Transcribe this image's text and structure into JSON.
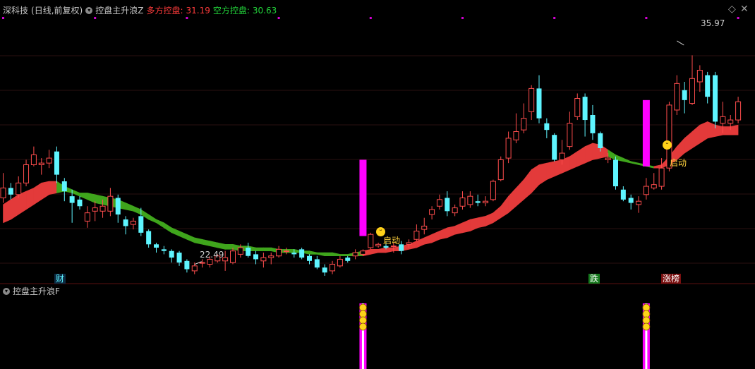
{
  "header": {
    "stock": "深科技",
    "period": "(日线,前复权)",
    "indicator": "控盘主升浪Z",
    "long_label": "多方控盘:",
    "long_value": "31.19",
    "short_label": "空方控盘:",
    "short_value": "30.63"
  },
  "subchart": {
    "indicator": "控盘主升浪F"
  },
  "controls": {
    "diamond": "◇",
    "close": "✕"
  },
  "annotations": {
    "high_price": "35.97",
    "low_price": "22.49",
    "start_label_1": "启动",
    "start_label_2": "启动",
    "tag_cai": "财",
    "tag_die": "跌",
    "tag_zhangbang": "涨榜"
  },
  "colors": {
    "up": "#ff4d4d",
    "down": "#5ef5ff",
    "band_up": "#e33a3a",
    "band_down": "#3fa51c",
    "signal": "#ff00ff",
    "dot": "#d400d4"
  },
  "chart_data": {
    "type": "candlestick",
    "title": "深科技 (日线,前复权)",
    "ylim": [
      21.5,
      37.5
    ],
    "candles": [
      [
        26.5,
        27.1,
        28.0,
        26.2
      ],
      [
        27.1,
        26.7,
        27.4,
        26.4
      ],
      [
        26.7,
        27.4,
        27.8,
        26.5
      ],
      [
        27.4,
        28.5,
        28.8,
        27.2
      ],
      [
        28.5,
        29.1,
        29.6,
        28.4
      ],
      [
        28.5,
        28.6,
        28.9,
        27.9
      ],
      [
        28.6,
        28.9,
        29.4,
        28.3
      ],
      [
        29.3,
        27.9,
        29.6,
        27.4
      ],
      [
        27.5,
        26.9,
        27.7,
        26.3
      ],
      [
        26.6,
        26.2,
        27.0,
        25.0
      ],
      [
        26.4,
        26.0,
        26.6,
        25.8
      ],
      [
        25.1,
        25.6,
        26.0,
        24.7
      ],
      [
        25.7,
        25.9,
        26.3,
        25.1
      ],
      [
        25.7,
        26.0,
        26.4,
        25.3
      ],
      [
        25.7,
        26.6,
        27.1,
        25.4
      ],
      [
        26.5,
        25.5,
        26.7,
        25.0
      ],
      [
        25.2,
        24.8,
        25.4,
        24.3
      ],
      [
        24.9,
        25.1,
        25.3,
        24.6
      ],
      [
        25.4,
        24.4,
        25.9,
        24.2
      ],
      [
        24.5,
        23.7,
        24.6,
        23.5
      ],
      [
        23.7,
        23.5,
        23.8,
        23.2
      ],
      [
        23.4,
        23.3,
        23.6,
        23.1
      ],
      [
        23.3,
        22.9,
        23.4,
        22.6
      ],
      [
        23.2,
        22.6,
        23.3,
        22.4
      ],
      [
        22.7,
        22.2,
        22.8,
        22.0
      ],
      [
        22.1,
        22.4,
        22.6,
        21.9
      ],
      [
        22.6,
        22.6,
        22.8,
        22.3
      ],
      [
        22.5,
        22.8,
        23.0,
        22.3
      ],
      [
        22.7,
        23.0,
        23.1,
        22.6
      ],
      [
        22.7,
        22.9,
        23.3,
        22.1
      ],
      [
        22.6,
        23.3,
        23.5,
        22.5
      ],
      [
        23.1,
        23.5,
        23.7,
        22.9
      ],
      [
        23.5,
        23.0,
        23.8,
        22.9
      ],
      [
        23.1,
        22.8,
        23.3,
        22.5
      ],
      [
        22.7,
        22.9,
        23.2,
        22.3
      ],
      [
        22.9,
        23.0,
        23.2,
        22.5
      ],
      [
        23.0,
        23.4,
        23.6,
        22.9
      ],
      [
        23.3,
        23.3,
        23.5,
        23.1
      ],
      [
        23.2,
        23.1,
        23.4,
        22.9
      ],
      [
        23.4,
        22.9,
        23.5,
        22.8
      ],
      [
        23.0,
        22.7,
        23.1,
        22.5
      ],
      [
        22.8,
        22.3,
        23.0,
        22.2
      ],
      [
        22.3,
        22.0,
        22.5,
        21.8
      ],
      [
        22.1,
        22.5,
        22.7,
        21.9
      ],
      [
        22.4,
        22.8,
        23.0,
        22.3
      ],
      [
        22.9,
        22.7,
        23.0,
        22.6
      ],
      [
        23.0,
        23.2,
        23.4,
        22.8
      ],
      [
        23.1,
        23.3,
        23.4,
        23.0
      ],
      [
        23.5,
        24.3,
        24.4,
        23.4
      ],
      [
        23.6,
        23.7,
        23.8,
        23.5
      ],
      [
        23.6,
        23.5,
        23.9,
        23.4
      ],
      [
        23.6,
        23.6,
        23.8,
        23.2
      ],
      [
        23.7,
        23.3,
        23.9,
        23.1
      ],
      [
        23.7,
        23.8,
        24.0,
        23.5
      ],
      [
        24.0,
        24.5,
        24.9,
        23.9
      ],
      [
        24.6,
        24.8,
        25.3,
        24.3
      ],
      [
        25.5,
        25.8,
        26.0,
        25.2
      ],
      [
        26.0,
        26.4,
        26.7,
        25.8
      ],
      [
        26.5,
        25.7,
        26.9,
        25.4
      ],
      [
        25.6,
        25.9,
        26.1,
        25.4
      ],
      [
        26.0,
        26.5,
        26.9,
        25.8
      ],
      [
        26.1,
        26.6,
        26.9,
        25.9
      ],
      [
        26.3,
        26.2,
        26.7,
        26.0
      ],
      [
        26.2,
        26.3,
        26.6,
        26.0
      ],
      [
        26.4,
        27.5,
        27.6,
        26.3
      ],
      [
        27.6,
        28.8,
        29.0,
        27.5
      ],
      [
        28.9,
        30.1,
        30.5,
        28.6
      ],
      [
        30.0,
        30.5,
        31.6,
        29.8
      ],
      [
        30.6,
        31.3,
        32.2,
        30.4
      ],
      [
        31.7,
        33.1,
        33.3,
        31.2
      ],
      [
        33.1,
        31.3,
        33.9,
        31.0
      ],
      [
        31.0,
        30.6,
        31.3,
        30.1
      ],
      [
        30.3,
        28.8,
        30.4,
        28.7
      ],
      [
        28.8,
        29.2,
        30.0,
        28.5
      ],
      [
        29.6,
        31.0,
        31.7,
        29.4
      ],
      [
        31.4,
        32.5,
        32.8,
        31.2
      ],
      [
        32.6,
        31.2,
        32.8,
        30.2
      ],
      [
        31.5,
        30.4,
        32.1,
        30.0
      ],
      [
        30.4,
        29.5,
        30.5,
        29.3
      ],
      [
        28.8,
        28.9,
        29.2,
        28.6
      ],
      [
        28.8,
        27.2,
        29.0,
        27.0
      ],
      [
        27.0,
        26.4,
        27.2,
        26.3
      ],
      [
        26.5,
        26.2,
        26.7,
        25.8
      ],
      [
        26.1,
        26.3,
        26.6,
        25.6
      ],
      [
        26.7,
        27.2,
        27.7,
        26.4
      ],
      [
        27.1,
        27.3,
        28.0,
        27.0
      ],
      [
        27.2,
        28.3,
        28.9,
        27.0
      ],
      [
        28.3,
        32.1,
        32.3,
        28.1
      ],
      [
        31.8,
        33.4,
        33.9,
        31.5
      ],
      [
        33.0,
        32.4,
        33.5,
        31.6
      ],
      [
        32.2,
        33.7,
        35.1,
        32.1
      ],
      [
        33.5,
        34.2,
        34.5,
        32.9
      ],
      [
        33.9,
        32.6,
        34.1,
        32.2
      ],
      [
        33.9,
        31.1,
        34.1,
        30.7
      ],
      [
        31.0,
        31.4,
        32.3,
        30.4
      ],
      [
        31.0,
        31.2,
        31.5,
        30.6
      ],
      [
        31.2,
        32.3,
        32.6,
        31.0
      ]
    ],
    "band_top": [
      26.1,
      26.4,
      26.7,
      26.9,
      27.1,
      27.4,
      27.5,
      27.5,
      27.2,
      27.0,
      26.8,
      26.8,
      26.7,
      26.6,
      26.5,
      26.4,
      26.2,
      26.0,
      25.8,
      25.5,
      25.2,
      25.0,
      24.7,
      24.5,
      24.3,
      24.1,
      24.0,
      23.9,
      23.8,
      23.7,
      23.7,
      23.6,
      23.6,
      23.5,
      23.5,
      23.5,
      23.4,
      23.4,
      23.4,
      23.3,
      23.3,
      23.2,
      23.2,
      23.2,
      23.1,
      23.1,
      23.2,
      23.3,
      23.4,
      23.4,
      23.5,
      23.5,
      23.6,
      23.7,
      23.9,
      24.1,
      24.3,
      24.5,
      24.7,
      24.8,
      25.0,
      25.2,
      25.3,
      25.4,
      25.6,
      26.0,
      26.6,
      27.1,
      27.6,
      28.2,
      28.5,
      28.6,
      28.7,
      28.8,
      29.0,
      29.3,
      29.6,
      29.8,
      29.7,
      29.4,
      29.1,
      28.9,
      28.7,
      28.6,
      28.5,
      28.4,
      28.5,
      29.0,
      29.6,
      30.1,
      30.5,
      30.9,
      31.1,
      30.9,
      30.8,
      30.8,
      30.9
    ],
    "band_bottom": [
      25.0,
      25.2,
      25.5,
      25.8,
      26.1,
      26.4,
      26.7,
      26.8,
      26.9,
      26.8,
      26.6,
      26.4,
      26.2,
      26.1,
      26.0,
      25.9,
      25.8,
      25.7,
      25.5,
      25.2,
      25.0,
      24.7,
      24.4,
      24.2,
      24.0,
      23.8,
      23.7,
      23.6,
      23.5,
      23.4,
      23.4,
      23.3,
      23.3,
      23.3,
      23.3,
      23.3,
      23.2,
      23.2,
      23.2,
      23.2,
      23.1,
      23.1,
      23.0,
      23.0,
      23.0,
      23.0,
      23.0,
      23.0,
      23.1,
      23.2,
      23.2,
      23.3,
      23.3,
      23.4,
      23.5,
      23.7,
      23.8,
      24.0,
      24.1,
      24.3,
      24.4,
      24.5,
      24.7,
      24.8,
      25.0,
      25.3,
      25.6,
      26.0,
      26.4,
      26.8,
      27.3,
      27.6,
      27.8,
      28.0,
      28.2,
      28.4,
      28.6,
      28.8,
      28.9,
      29.0,
      28.8,
      28.7,
      28.6,
      28.5,
      28.4,
      28.3,
      28.3,
      28.5,
      28.8,
      29.2,
      29.5,
      29.8,
      30.1,
      30.2,
      30.3,
      30.3,
      30.3
    ],
    "band_dir": [
      1,
      1,
      1,
      1,
      1,
      1,
      1,
      0,
      0,
      0,
      0,
      0,
      0,
      0,
      0,
      0,
      0,
      0,
      0,
      0,
      0,
      0,
      0,
      0,
      0,
      0,
      0,
      0,
      0,
      0,
      0,
      0,
      0,
      0,
      0,
      0,
      0,
      0,
      0,
      0,
      0,
      0,
      0,
      0,
      0,
      0,
      0,
      1,
      1,
      1,
      1,
      1,
      1,
      1,
      1,
      1,
      1,
      1,
      1,
      1,
      1,
      1,
      1,
      1,
      1,
      1,
      1,
      1,
      1,
      1,
      1,
      1,
      1,
      1,
      1,
      1,
      1,
      1,
      1,
      0,
      0,
      0,
      0,
      0,
      0,
      1,
      1,
      1,
      1,
      1,
      1,
      1,
      1,
      1,
      1,
      1,
      1
    ],
    "signal_index": [
      47,
      84
    ],
    "signal_bars": [
      [
        28.8,
        24.2
      ],
      [
        32.4,
        28.4
      ]
    ],
    "high": {
      "index": 88,
      "value": 35.97
    },
    "low": {
      "index": 25,
      "value": 22.49
    }
  }
}
